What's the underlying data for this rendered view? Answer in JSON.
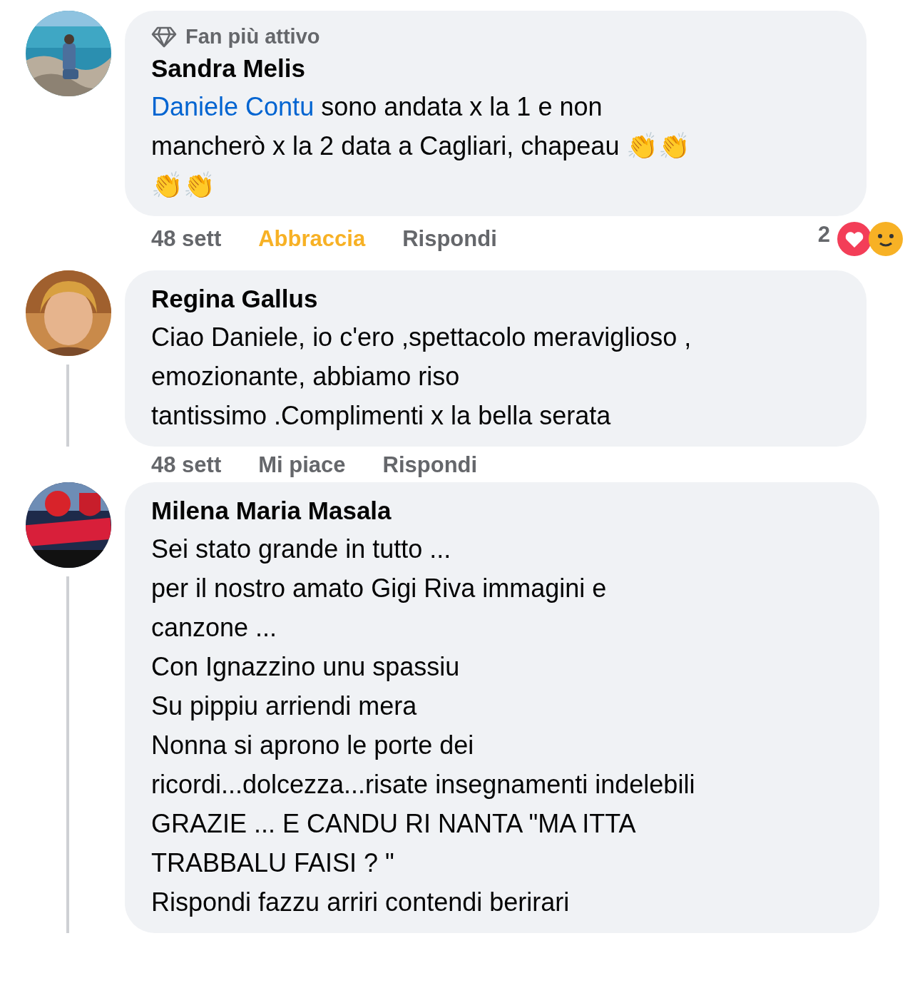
{
  "comments": [
    {
      "badge": "Fan più attivo",
      "author": "Sandra Melis",
      "mention": "Daniele Contu",
      "text": " sono andata x la 1 e non\nmancherò x la 2 data a Cagliari, chapeau 👏👏\n👏👏",
      "meta": {
        "time": "48 sett",
        "action": "Abbraccia",
        "reacted": true,
        "reply": "Rispondi",
        "reaction_count": "2"
      },
      "thread": false
    },
    {
      "author": "Regina Gallus",
      "text": "Ciao Daniele, io c'ero ,spettacolo meraviglioso , emozionante, abbiamo riso\ntantissimo .Complimenti x la bella serata",
      "meta": {
        "time": "48 sett",
        "action": "Mi piace",
        "reacted": false,
        "reply": "Rispondi"
      },
      "thread": true
    },
    {
      "author": "Milena Maria Masala",
      "text": "Sei stato grande in tutto ...\nper il nostro amato Gigi Riva immagini e\ncanzone ...\nCon Ignazzino unu spassiu\nSu pippiu arriendi mera\nNonna si aprono le porte dei\nricordi...dolcezza...risate insegnamenti indelebili\nGRAZIE ... E CANDU RI NANTA \"MA ITTA\nTRABBALU FAISI ? \"\nRispondi fazzu arriri contendi berirari",
      "thread": true
    }
  ]
}
